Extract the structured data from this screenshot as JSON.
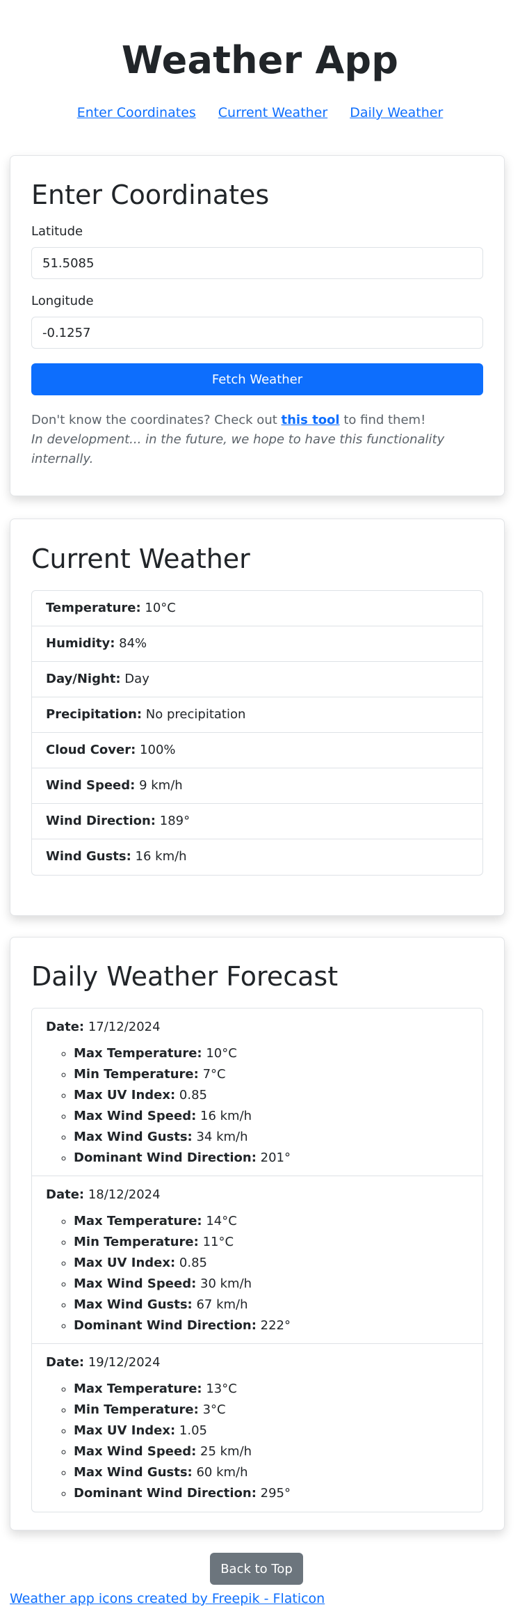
{
  "app": {
    "title": "Weather App"
  },
  "nav": {
    "items": [
      {
        "label": "Enter Coordinates"
      },
      {
        "label": "Current Weather"
      },
      {
        "label": "Daily Weather"
      }
    ]
  },
  "coords": {
    "heading": "Enter Coordinates",
    "latitude_label": "Latitude",
    "latitude_value": "51.5085",
    "longitude_label": "Longitude",
    "longitude_value": "-0.1257",
    "fetch_label": "Fetch Weather",
    "hint_prefix": "Don't know the coordinates? Check out ",
    "hint_link": "this tool",
    "hint_suffix": " to find them!",
    "hint_note": "In development... in the future, we hope to have this functionality internally."
  },
  "current": {
    "heading": "Current Weather",
    "rows": [
      {
        "label": "Temperature:",
        "value": " 10°C"
      },
      {
        "label": "Humidity:",
        "value": " 84%"
      },
      {
        "label": "Day/Night:",
        "value": " Day"
      },
      {
        "label": "Precipitation:",
        "value": " No precipitation"
      },
      {
        "label": "Cloud Cover:",
        "value": " 100%"
      },
      {
        "label": "Wind Speed:",
        "value": " 9 km/h"
      },
      {
        "label": "Wind Direction:",
        "value": " 189°"
      },
      {
        "label": "Wind Gusts:",
        "value": " 16 km/h"
      }
    ]
  },
  "daily": {
    "heading": "Daily Weather Forecast",
    "date_label": "Date:",
    "labels": {
      "max_temp": "Max Temperature:",
      "min_temp": "Min Temperature:",
      "max_uv": "Max UV Index:",
      "max_wind": "Max Wind Speed:",
      "max_gusts": "Max Wind Gusts:",
      "wind_dir": "Dominant Wind Direction:"
    },
    "days": [
      {
        "date": " 17/12/2024",
        "max_temp": " 10°C",
        "min_temp": " 7°C",
        "max_uv": " 0.85",
        "max_wind": " 16 km/h",
        "max_gusts": " 34 km/h",
        "wind_dir": " 201°"
      },
      {
        "date": " 18/12/2024",
        "max_temp": " 14°C",
        "min_temp": " 11°C",
        "max_uv": " 0.85",
        "max_wind": " 30 km/h",
        "max_gusts": " 67 km/h",
        "wind_dir": " 222°"
      },
      {
        "date": " 19/12/2024",
        "max_temp": " 13°C",
        "min_temp": " 3°C",
        "max_uv": " 1.05",
        "max_wind": " 25 km/h",
        "max_gusts": " 60 km/h",
        "wind_dir": " 295°"
      }
    ]
  },
  "footer": {
    "back_label": "Back to Top",
    "credit": "Weather app icons created by Freepik - Flaticon"
  }
}
